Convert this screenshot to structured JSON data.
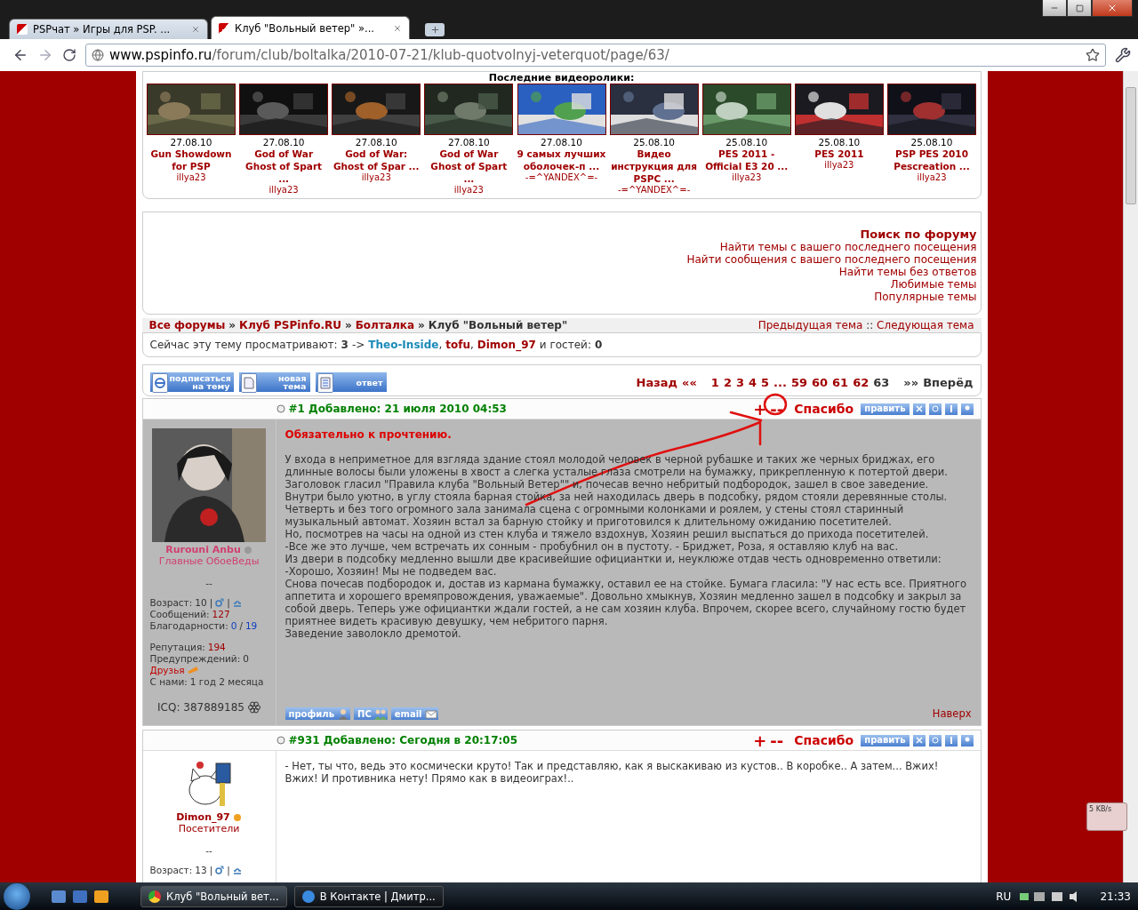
{
  "browser": {
    "tabs": [
      {
        "title": "PSPчат » Игры для PSP. ...",
        "selected": false
      },
      {
        "title": "Клуб \"Вольный ветер\" »...",
        "selected": true
      }
    ],
    "url": {
      "domain": "www.pspinfo.ru",
      "path": "/forum/club/boltalka/2010-07-21/klub-quotvolnyj-veterquot/page/63/"
    }
  },
  "videos": {
    "heading": "Последние видеоролики:",
    "items": [
      {
        "date": "27.08.10",
        "title": "Gun Showdown for PSP",
        "author": "illya23"
      },
      {
        "date": "27.08.10",
        "title": "God of War Ghost of Spart ...",
        "author": "illya23"
      },
      {
        "date": "27.08.10",
        "title": "God of War: Ghost of Spar ...",
        "author": "illya23"
      },
      {
        "date": "27.08.10",
        "title": "God of War Ghost of Spart ...",
        "author": "illya23"
      },
      {
        "date": "27.08.10",
        "title": "9 самых лучших оболочек-п ...",
        "author": "-=^YANDEX^=-"
      },
      {
        "date": "25.08.10",
        "title": "Видео инструкция для PSPC ...",
        "author": "-=^YANDEX^=-"
      },
      {
        "date": "25.08.10",
        "title": "PES 2011 - Official E3 20 ...",
        "author": "illya23"
      },
      {
        "date": "25.08.10",
        "title": "PES 2011",
        "author": "illya23"
      },
      {
        "date": "25.08.10",
        "title": "PSP PES 2010 Pescreation ...",
        "author": "illya23"
      }
    ]
  },
  "search": {
    "title": "Поиск по форуму",
    "links": [
      "Найти темы с вашего последнего посещения",
      "Найти сообщения с вашего последнего посещения",
      "Найти темы без ответов",
      "Любимые темы",
      "Популярные темы"
    ]
  },
  "breadcrumb": [
    {
      "label": "Все форумы",
      "sep": "»"
    },
    {
      "label": "Клуб PSPinfo.RU",
      "sep": "»"
    },
    {
      "label": "Болталка",
      "sep": "»"
    },
    {
      "label": "Клуб \"Вольный ветер\""
    }
  ],
  "topic_nav": {
    "prev": "Предыдущая тема",
    "sep": "::",
    "next": "Следующая тема"
  },
  "viewers": {
    "label": "Сейчас эту тему просматривают:",
    "count": "3",
    "arrow": "->",
    "users": [
      {
        "name": "Theo-Inside",
        "color": "#1a8ab8",
        "sep": ","
      },
      {
        "name": "tofu",
        "color": "#a00000",
        "sep": ","
      },
      {
        "name": "Dimon_97",
        "color": "#a00000"
      }
    ],
    "guests_label": "и гостей:",
    "guests": "0"
  },
  "actions": [
    {
      "kind": "subscribe",
      "label": "подписаться на тему"
    },
    {
      "kind": "new",
      "label": "новая тема"
    },
    {
      "kind": "reply",
      "label": "ответ"
    }
  ],
  "pagination": {
    "back": "Назад",
    "prev": "««",
    "pages": [
      {
        "label": "1",
        "selected": false
      },
      {
        "label": "2",
        "selected": false
      },
      {
        "label": "3",
        "selected": false
      },
      {
        "label": "4",
        "selected": false
      },
      {
        "label": "5",
        "selected": false
      },
      {
        "label": "...",
        "selected": false
      },
      {
        "label": "59",
        "selected": false
      },
      {
        "label": "60",
        "selected": false
      },
      {
        "label": "61",
        "selected": false
      },
      {
        "label": "62",
        "selected": false
      },
      {
        "label": "63",
        "selected": true
      }
    ],
    "next": "»»",
    "forward": "Вперёд"
  },
  "posts": [
    {
      "highlighted": true,
      "number": "#1",
      "added": "Добавлено: 21 июля 2010 04:53",
      "plus": "+",
      "minus": "--",
      "thanks": "Спасибо",
      "edit": "править",
      "author": {
        "name": "Rurouni Anbu",
        "online": false,
        "group": "Главные ОбоеВеды",
        "color": "#d04070",
        "dash": "--",
        "stat_groups": [
          [
            {
              "kind": "age",
              "label": "Возраст:",
              "value": "10",
              "sep": "|"
            },
            {
              "kind": "count",
              "label": "Сообщений:",
              "value": "127"
            },
            {
              "kind": "ratio",
              "label": "Благодарности:",
              "value": "0",
              "sep": "/",
              "total": "19"
            }
          ],
          [
            {
              "kind": "count",
              "label": "Репутация:",
              "value": "194"
            },
            {
              "kind": "plain",
              "label": "Предупреждений:",
              "value": "0"
            },
            {
              "kind": "friends",
              "label": "Друзья"
            },
            {
              "kind": "plain",
              "label": "С нами:",
              "value": "1 год 2 месяца"
            }
          ]
        ],
        "icq": "ICQ: 387889185"
      },
      "title": "Обязательно к прочтению.",
      "paragraphs": [
        "У входа в неприметное для взгляда здание стоял молодой человек в черной рубашке и таких же черных бриджах, его длинные волосы были уложены в хвост а слегка усталые глаза смотрели на бумажку, прикрепленную к потертой двери. Заголовок гласил \"Правила клуба \"Вольный Ветер\"\" и, почесав вечно небритый подбородок, зашел в свое заведение.",
        "Внутри было уютно, в углу стояла барная стойка, за ней находилась дверь в подсобку, рядом стояли деревянные столы. Четверть и без того огромного зала занимала сцена с огромными колонками и роялем, у стены стоял старинный музыкальный автомат. Хозяин встал за барную стойку и приготовился к длительному ожиданию посетителей.",
        "Но, посмотрев на часы на одной из стен клуба и тяжело вздохнув, Хозяин решил выспаться до прихода посетителей.",
        "-Все же это лучше, чем встречать их сонным - пробубнил он в пустоту. - Бриджет, Роза, я оставляю клуб на вас.",
        "Из двери в подсобку медленно вышли две красивейшие официантки и, неуклюже отдав честь одновременно ответили:",
        "-Хорошо, Хозяин! Мы не подведем вас.",
        "Снова почесав подбородок и, достав из кармана бумажку, оставил ее на стойке. Бумага гласила: \"У нас есть все. Приятного аппетита и хорошего времяпровождения, уважаемые\". Довольно хмыкнув, Хозяин медленно зашел в подсобку и закрыл за собой дверь. Теперь уже официантки ждали гостей, а не сам хозяин клуба. Впрочем, скорее всего, случайному гостю будет приятнее видеть красивую девушку, чем небритого парня.",
        "Заведение заволокло дремотой."
      ],
      "footer": [
        {
          "kind": "profile",
          "label": "профиль"
        },
        {
          "kind": "pm",
          "label": "ПС"
        },
        {
          "kind": "email",
          "label": "email"
        }
      ],
      "top_link": "Наверх"
    },
    {
      "highlighted": false,
      "number": "#931",
      "added": "Добавлено: Сегодня в 20:17:05",
      "plus": "+",
      "minus": "--",
      "thanks": "Спасибо",
      "edit": "править",
      "author": {
        "name": "Dimon_97",
        "online": true,
        "group": "Посетители",
        "color": "#a00000",
        "dash": "--",
        "stat_groups": [
          [
            {
              "kind": "age",
              "label": "Возраст:",
              "value": "13",
              "sep": "|"
            }
          ]
        ]
      },
      "paragraphs": [
        "- Нет, ты что, ведь это космически круто! Так и представляю, как я выскакиваю из кустов.. В коробке.. А затем... Вжих! Вжих! И противника нету! Прямо как в видеоиграх!.."
      ]
    }
  ],
  "net_meter": {
    "reading": "5 KB/s"
  },
  "taskbar": {
    "tasks": [
      {
        "label": "Клуб \"Вольный вет...",
        "selected": true,
        "kind": "chrome"
      },
      {
        "label": "В Контакте | Дмитр...",
        "selected": false,
        "kind": "ie"
      }
    ],
    "lang": "RU",
    "time": "21:33"
  }
}
